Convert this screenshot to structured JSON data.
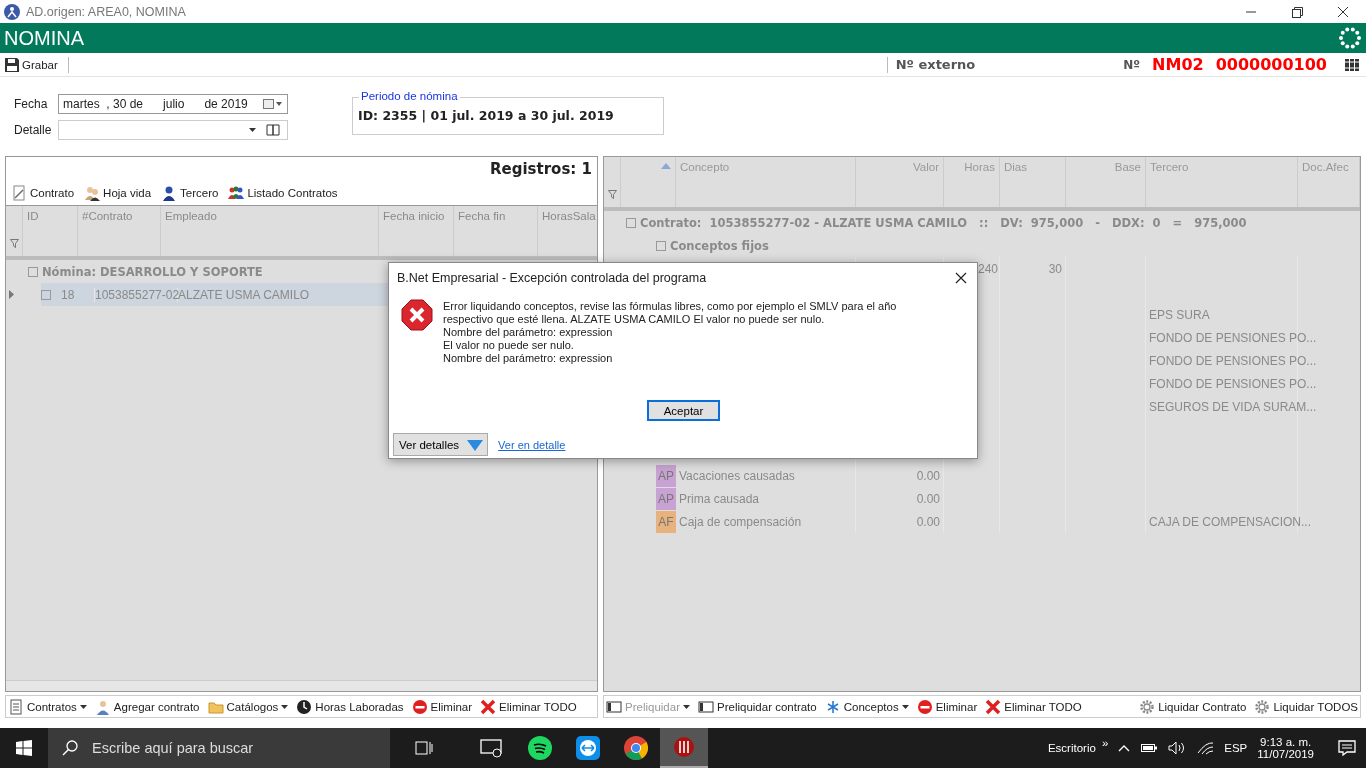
{
  "window": {
    "title": "AD.origen: AREA0, NOMINA"
  },
  "header": {
    "title": "NOMINA"
  },
  "toolbar": {
    "save": "Grabar",
    "external_label": "Nº externo",
    "number_label": "Nº",
    "series": "NM02",
    "number": "0000000100"
  },
  "form": {
    "fecha_label": "Fecha",
    "fecha_value": "martes  , 30 de      julio      de 2019",
    "detalle_label": "Detalle",
    "periodo_legend": "Periodo de nómina",
    "periodo_value": "ID: 2355 | 01 jul. 2019 a 30 jul. 2019"
  },
  "contracts_panel": {
    "records": "Registros: 1",
    "actions": [
      {
        "label": "Contrato",
        "kind": "contract"
      },
      {
        "label": "Hoja vida",
        "kind": "people"
      },
      {
        "label": "Tercero",
        "kind": "person"
      },
      {
        "label": "Listado Contratos",
        "kind": "group"
      }
    ],
    "columns": [
      "ID",
      "#Contrato",
      "Empleado",
      "Fecha inicio",
      "Fecha fin",
      "HorasSala"
    ],
    "group": "Nómina: DESARROLLO Y SOPORTE",
    "rows": [
      {
        "selected": true,
        "id": "18",
        "contrato": "1053855277-02",
        "empleado": "ALZATE USMA CAMILO"
      }
    ]
  },
  "concepts_panel": {
    "columns": [
      "Concepto",
      "Valor",
      "Horas",
      "Dias",
      "Base",
      "Tercero",
      "Doc.Afec"
    ],
    "group": "Contrato:  1053855277-02 - ALZATE USMA CAMILO   ::   DV:  975,000   -   DDX:  0   =   975,000",
    "subgroup": "Conceptos fijos",
    "rows": [
      {
        "kind": "concept",
        "horas": "240",
        "dias": "30"
      },
      {
        "kind": "blank"
      },
      {
        "kind": "concept",
        "tercero": "EPS SURA"
      },
      {
        "kind": "concept",
        "tercero": "FONDO DE PENSIONES PO..."
      },
      {
        "kind": "concept",
        "tercero": "FONDO DE PENSIONES PO..."
      },
      {
        "kind": "concept",
        "tercero": "FONDO DE PENSIONES PO..."
      },
      {
        "kind": "concept",
        "tercero": "SEGUROS DE VIDA SURAM..."
      },
      {
        "kind": "blank"
      },
      {
        "kind": "blank"
      },
      {
        "kind": "concept",
        "badge": "AP",
        "color": "#c8a2d2",
        "concepto": "Vacaciones causadas",
        "valor": "0.00"
      },
      {
        "kind": "concept",
        "badge": "AP",
        "color": "#c8a2d2",
        "concepto": "Prima causada",
        "valor": "0.00"
      },
      {
        "kind": "concept",
        "badge": "AF",
        "color": "#e8b27e",
        "concepto": "Caja de compensación",
        "valor": "0.00",
        "tercero": "CAJA DE COMPENSACION..."
      }
    ]
  },
  "bottom_left": [
    {
      "label": "Contratos",
      "kind": "contracts",
      "dropdown": true
    },
    {
      "label": "Agregar contrato",
      "kind": "add-person",
      "dropdown": false
    },
    {
      "label": "Catálogos",
      "kind": "folder",
      "dropdown": true
    },
    {
      "label": "Horas Laboradas",
      "kind": "clock",
      "dropdown": false
    },
    {
      "label": "Eliminar",
      "kind": "delete",
      "dropdown": false
    },
    {
      "label": "Eliminar TODO",
      "kind": "delete-all",
      "dropdown": false
    }
  ],
  "bottom_right": [
    {
      "label": "Preliquidar",
      "kind": "preview",
      "dropdown": true,
      "disabled": true
    },
    {
      "label": "Preliquidar contrato",
      "kind": "preview",
      "dropdown": false,
      "disabled": false
    },
    {
      "label": "Conceptos",
      "kind": "asterisk",
      "dropdown": true,
      "disabled": false
    },
    {
      "label": "Eliminar",
      "kind": "delete",
      "dropdown": false,
      "disabled": false
    },
    {
      "label": "Eliminar TODO",
      "kind": "delete-all",
      "dropdown": false,
      "disabled": false
    },
    {
      "label": "Liquidar Contrato",
      "kind": "gear",
      "dropdown": false,
      "disabled": false
    },
    {
      "label": "Liquidar TODOS",
      "kind": "gear",
      "dropdown": false,
      "disabled": false
    }
  ],
  "dialog": {
    "title": "B.Net Empresarial - Excepción controlada del programa",
    "lines": [
      "Error liquidando conceptos, revise las fórmulas libres, como por ejemplo el SMLV para el año",
      "respectivo que esté llena. ALZATE USMA CAMILO El valor no puede ser nulo.",
      "Nombre del parámetro: expression",
      "El valor no puede ser nulo.",
      "Nombre del parámetro: expression"
    ],
    "ok": "Aceptar",
    "details": "Ver detalles",
    "link": "Ver en detalle"
  },
  "taskbar": {
    "search_placeholder": "Escribe aquí para buscar",
    "desktop": "Escritorio",
    "chevron": "»",
    "language": "ESP",
    "time": "9:13 a. m.",
    "date": "11/07/2019"
  }
}
